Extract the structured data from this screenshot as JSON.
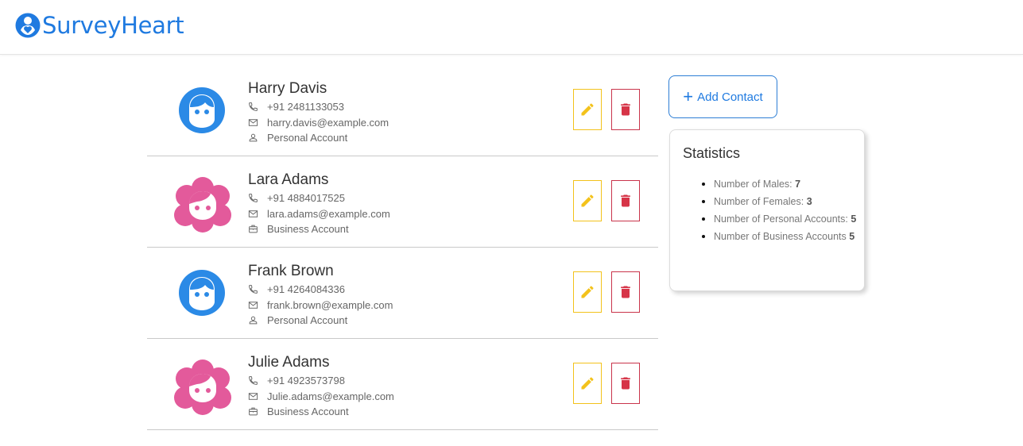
{
  "app": {
    "brand": "SurveyHeart"
  },
  "actions": {
    "add_contact_label": "Add Contact"
  },
  "contacts": [
    {
      "name": "Harry Davis",
      "phone": "+91 2481133053",
      "email": "harry.davis@example.com",
      "account": "Personal Account",
      "gender": "male"
    },
    {
      "name": "Lara Adams",
      "phone": "+91 4884017525",
      "email": "lara.adams@example.com",
      "account": "Business Account",
      "gender": "female"
    },
    {
      "name": "Frank Brown",
      "phone": "+91 4264084336",
      "email": "frank.brown@example.com",
      "account": "Personal Account",
      "gender": "male"
    },
    {
      "name": "Julie Adams",
      "phone": "+91 4923573798",
      "email": "Julie.adams@example.com",
      "account": "Business Account",
      "gender": "female"
    }
  ],
  "statistics": {
    "title": "Statistics",
    "items": [
      {
        "label": "Number of Males:",
        "value": "7"
      },
      {
        "label": "Number of Females:",
        "value": "3"
      },
      {
        "label": "Number of Personal Accounts:",
        "value": "5"
      },
      {
        "label": "Number of Business Accounts",
        "value": "5"
      }
    ]
  },
  "colors": {
    "brand": "#1f7ae0",
    "male_avatar": "#2b8ae6",
    "female_avatar": "#e35a9b",
    "edit_accent": "#f3c21b",
    "delete_accent": "#d63447"
  }
}
